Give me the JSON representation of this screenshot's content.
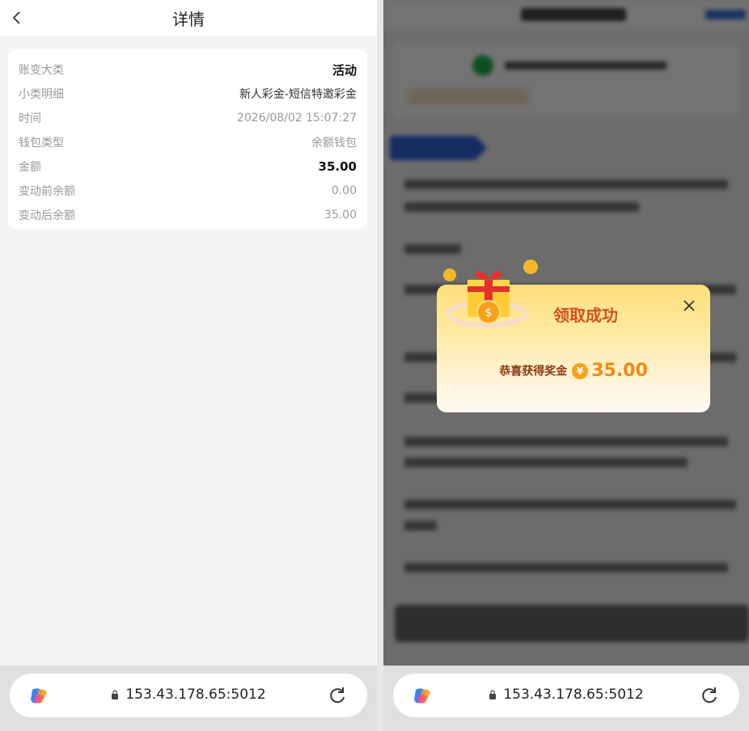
{
  "left": {
    "header": {
      "title": "详情"
    },
    "details": [
      {
        "key": "账变大类",
        "value": "活动",
        "style": "strong"
      },
      {
        "key": "小类明细",
        "value": "新人彩金-短信特邀彩金",
        "style": "dark"
      },
      {
        "key": "时间",
        "value": "2026/08/02 15:07:27",
        "style": "muted"
      },
      {
        "key": "钱包类型",
        "value": "余额钱包",
        "style": "muted"
      },
      {
        "key": "金额",
        "value": "35.00",
        "style": "strong"
      },
      {
        "key": "变动前余额",
        "value": "0.00",
        "style": "muted"
      },
      {
        "key": "变动后余额",
        "value": "35.00",
        "style": "muted"
      }
    ],
    "browser": {
      "address": "153.43.178.65:5012"
    }
  },
  "right": {
    "popup": {
      "title": "领取成功",
      "label": "恭喜获得奖金",
      "currency_symbol": "¥",
      "amount": "35.00"
    },
    "browser": {
      "address": "153.43.178.65:5012"
    }
  },
  "colors": {
    "popup_title": "#d2521c",
    "amount": "#f28a12",
    "accent_blue": "#2d62d8"
  }
}
